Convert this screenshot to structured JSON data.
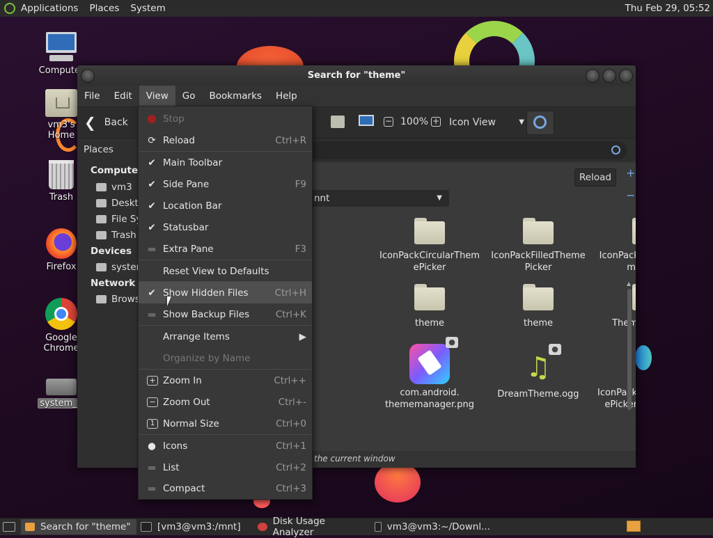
{
  "top_panel": {
    "menus": [
      "Applications",
      "Places",
      "System"
    ],
    "clock": "Thu Feb 29, 05:52"
  },
  "desktop_icons": [
    "Computer",
    "vm3's Home",
    "Trash",
    "Firefox",
    "Google Chrome",
    "system_e"
  ],
  "window": {
    "title": "Search for \"theme\"",
    "menubar": [
      "File",
      "Edit",
      "View",
      "Go",
      "Bookmarks",
      "Help"
    ],
    "toolbar": {
      "back_label": "Back",
      "zoom": "100%",
      "view_mode": "Icon View"
    },
    "reload_label": "Reload",
    "path_dropdown": "nnt",
    "statusbar_text": "the current window",
    "side_pane": {
      "header": "Places",
      "sections": [
        {
          "title": "Computer",
          "items": [
            "vm3",
            "Deskt",
            "File Sy",
            "Trash"
          ]
        },
        {
          "title": "Devices",
          "items": [
            "system"
          ]
        },
        {
          "title": "Network",
          "items": [
            "Brows"
          ]
        }
      ]
    },
    "files": [
      {
        "name": "IconPackCircularThem ePicker",
        "type": "folder"
      },
      {
        "name": "IconPackFilledTheme Picker",
        "type": "folder"
      },
      {
        "name": "IconPackRoundedThe mePicker",
        "type": "folder"
      },
      {
        "name": "theme",
        "type": "folder"
      },
      {
        "name": "theme",
        "type": "folder"
      },
      {
        "name": "ThemeManager",
        "type": "folder"
      },
      {
        "name": "com.android. thememanager.png",
        "type": "image"
      },
      {
        "name": "DreamTheme.ogg",
        "type": "audio"
      },
      {
        "name": "IconPackCircularThem ePickerOverlay.apk",
        "type": "document"
      }
    ]
  },
  "view_menu": {
    "items": [
      {
        "label": "Stop",
        "accel": "",
        "state": "disabled-stop"
      },
      {
        "label": "Reload",
        "accel": "Ctrl+R",
        "state": "reload"
      },
      {
        "label": "Main Toolbar",
        "accel": "",
        "state": "checked"
      },
      {
        "label": "Side Pane",
        "accel": "F9",
        "state": "checked"
      },
      {
        "label": "Location Bar",
        "accel": "",
        "state": "checked"
      },
      {
        "label": "Statusbar",
        "accel": "",
        "state": "checked"
      },
      {
        "label": "Extra Pane",
        "accel": "F3",
        "state": "unchecked"
      },
      {
        "label": "Reset View to Defaults",
        "accel": "",
        "state": "none"
      },
      {
        "label": "Show Hidden Files",
        "accel": "Ctrl+H",
        "state": "checked-highlight"
      },
      {
        "label": "Show Backup Files",
        "accel": "Ctrl+K",
        "state": "unchecked"
      },
      {
        "label": "Arrange Items",
        "accel": "",
        "state": "submenu"
      },
      {
        "label": "Organize by Name",
        "accel": "",
        "state": "disabled"
      },
      {
        "label": "Zoom In",
        "accel": "Ctrl++",
        "state": "zoom-in"
      },
      {
        "label": "Zoom Out",
        "accel": "Ctrl+-",
        "state": "zoom-out"
      },
      {
        "label": "Normal Size",
        "accel": "Ctrl+0",
        "state": "zoom-normal"
      },
      {
        "label": "Icons",
        "accel": "Ctrl+1",
        "state": "radio-on"
      },
      {
        "label": "List",
        "accel": "Ctrl+2",
        "state": "radio-off"
      },
      {
        "label": "Compact",
        "accel": "Ctrl+3",
        "state": "radio-off"
      }
    ]
  },
  "taskbar": {
    "tasks": [
      "Search for \"theme\"",
      "[vm3@vm3:/mnt]",
      "Disk Usage Analyzer",
      "vm3@vm3:~/Downl..."
    ]
  },
  "colors": {
    "menu_bg": "#383838",
    "highlight": "#4f4f4f",
    "panel_bg": "#2b2b2b",
    "desktop_bg": "#240d24"
  }
}
